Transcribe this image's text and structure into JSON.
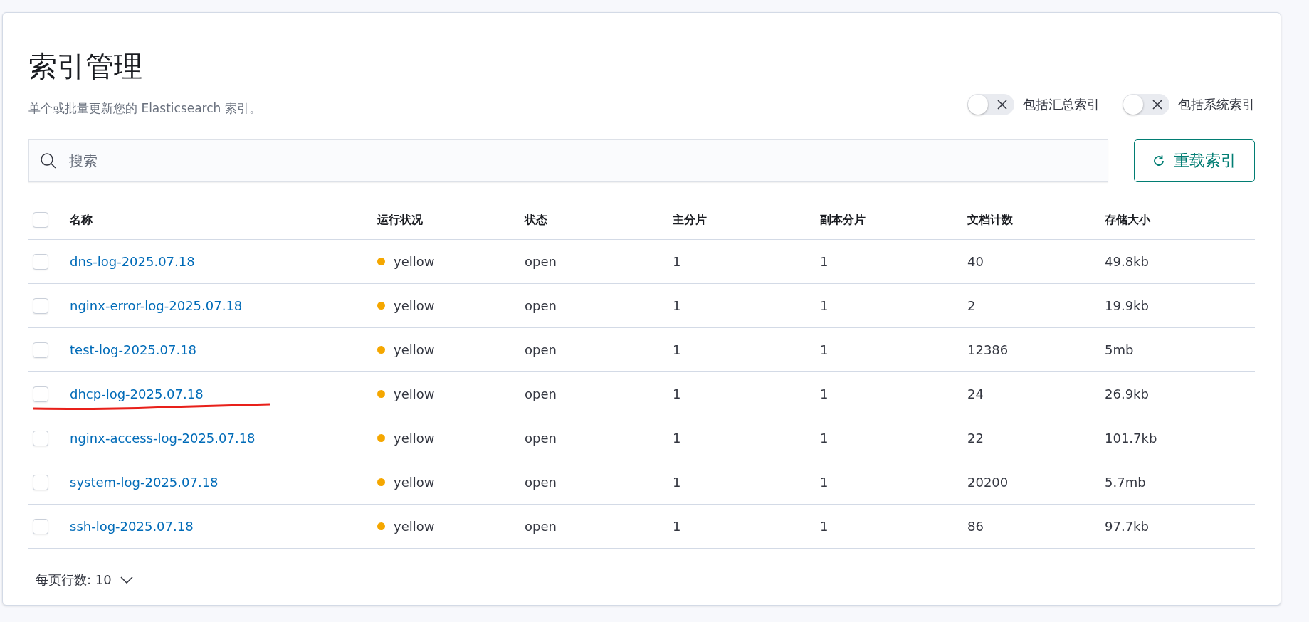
{
  "page": {
    "title": "索引管理",
    "description": "单个或批量更新您的 Elasticsearch 索引。"
  },
  "toggles": [
    {
      "label": "包括汇总索引",
      "on": false
    },
    {
      "label": "包括系统索引",
      "on": false
    }
  ],
  "search": {
    "placeholder": "搜索"
  },
  "reload_button": {
    "label": "重载索引"
  },
  "table": {
    "select_all": {
      "checked": false
    },
    "columns": [
      "名称",
      "运行状况",
      "状态",
      "主分片",
      "副本分片",
      "文档计数",
      "存储大小"
    ],
    "rows": [
      {
        "name": "dns-log-2025.07.18",
        "health": "yellow",
        "color": "#f5a700",
        "status": "open",
        "primary": "1",
        "replica": "1",
        "docs": "40",
        "size": "49.8kb",
        "checked": false,
        "underlined": false
      },
      {
        "name": "nginx-error-log-2025.07.18",
        "health": "yellow",
        "color": "#f5a700",
        "status": "open",
        "primary": "1",
        "replica": "1",
        "docs": "2",
        "size": "19.9kb",
        "checked": false,
        "underlined": false
      },
      {
        "name": "test-log-2025.07.18",
        "health": "yellow",
        "color": "#f5a700",
        "status": "open",
        "primary": "1",
        "replica": "1",
        "docs": "12386",
        "size": "5mb",
        "checked": false,
        "underlined": false
      },
      {
        "name": "dhcp-log-2025.07.18",
        "health": "yellow",
        "color": "#f5a700",
        "status": "open",
        "primary": "1",
        "replica": "1",
        "docs": "24",
        "size": "26.9kb",
        "checked": false,
        "underlined": true
      },
      {
        "name": "nginx-access-log-2025.07.18",
        "health": "yellow",
        "color": "#f5a700",
        "status": "open",
        "primary": "1",
        "replica": "1",
        "docs": "22",
        "size": "101.7kb",
        "checked": false,
        "underlined": false
      },
      {
        "name": "system-log-2025.07.18",
        "health": "yellow",
        "color": "#f5a700",
        "status": "open",
        "primary": "1",
        "replica": "1",
        "docs": "20200",
        "size": "5.7mb",
        "checked": false,
        "underlined": false
      },
      {
        "name": "ssh-log-2025.07.18",
        "health": "yellow",
        "color": "#f5a700",
        "status": "open",
        "primary": "1",
        "replica": "1",
        "docs": "86",
        "size": "97.7kb",
        "checked": false,
        "underlined": false
      }
    ]
  },
  "pagination": {
    "rows_per_page": "每页行数: 10"
  }
}
